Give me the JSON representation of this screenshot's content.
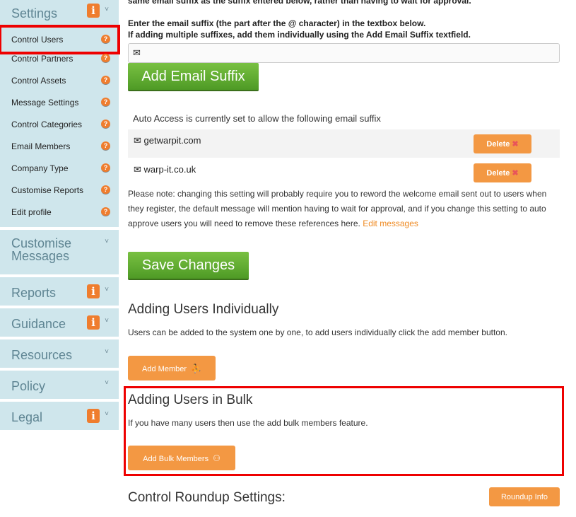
{
  "sidebar": {
    "settings": {
      "title": "Settings",
      "info": "i",
      "chevron": "˅",
      "items": [
        {
          "label": "Control Users",
          "help": "?",
          "active": true
        },
        {
          "label": "Control Partners",
          "help": "?"
        },
        {
          "label": "Control Assets",
          "help": "?"
        },
        {
          "label": "Message Settings",
          "help": "?"
        },
        {
          "label": "Control Categories",
          "help": "?"
        },
        {
          "label": "Email Members",
          "help": "?"
        },
        {
          "label": "Company Type",
          "help": "?"
        },
        {
          "label": "Customise Reports",
          "help": "?"
        },
        {
          "label": "Edit profile",
          "help": "?"
        }
      ]
    },
    "sections": [
      {
        "title": "Customise Messages",
        "info": false
      },
      {
        "title": "Reports",
        "info": true
      },
      {
        "title": "Guidance",
        "info": true
      },
      {
        "title": "Resources",
        "info": false
      },
      {
        "title": "Policy",
        "info": false
      },
      {
        "title": "Legal",
        "info": true
      }
    ]
  },
  "main": {
    "intro_clipped": "same email suffix as the suffix entered below, rather than having to wait for approval.",
    "instructions_line1": "Enter the email suffix (the part after the @ character) in the textbox below.",
    "instructions_line2": "If adding multiple suffixes, add them individually using the Add Email Suffix textfield.",
    "suffix_input": {
      "value": "",
      "placeholder": "",
      "icon": "envelope-icon"
    },
    "add_suffix_label": "Add Email Suffix",
    "auto_access_label": "Auto Access is currently set to allow the following email suffix",
    "suffixes": [
      {
        "name": "getwarpit.com",
        "delete_label": "Delete"
      },
      {
        "name": "warp-it.co.uk",
        "delete_label": "Delete"
      }
    ],
    "note_text": "Please note: changing this setting will probably require you to reword the welcome email sent out to users when they register, the default message will mention having to wait for approval, and if you change this setting to auto approve users you will need to remove these references here.",
    "note_link": "Edit messages",
    "save_label": "Save Changes",
    "individual": {
      "heading": "Adding Users Individually",
      "text": "Users can be added to the system one by one, to add users individually click the add member button.",
      "button": "Add Member"
    },
    "bulk": {
      "heading": "Adding Users in Bulk",
      "text": "If you have many users then use the add bulk members feature.",
      "button": "Add Bulk Members"
    },
    "roundup": {
      "heading": "Control Roundup Settings:",
      "button": "Roundup Info"
    }
  },
  "colors": {
    "sidebar_bg": "#cfe6ec",
    "accent_orange": "#f39843",
    "green_button": "#5aa72e",
    "highlight_red": "#ee0000"
  }
}
